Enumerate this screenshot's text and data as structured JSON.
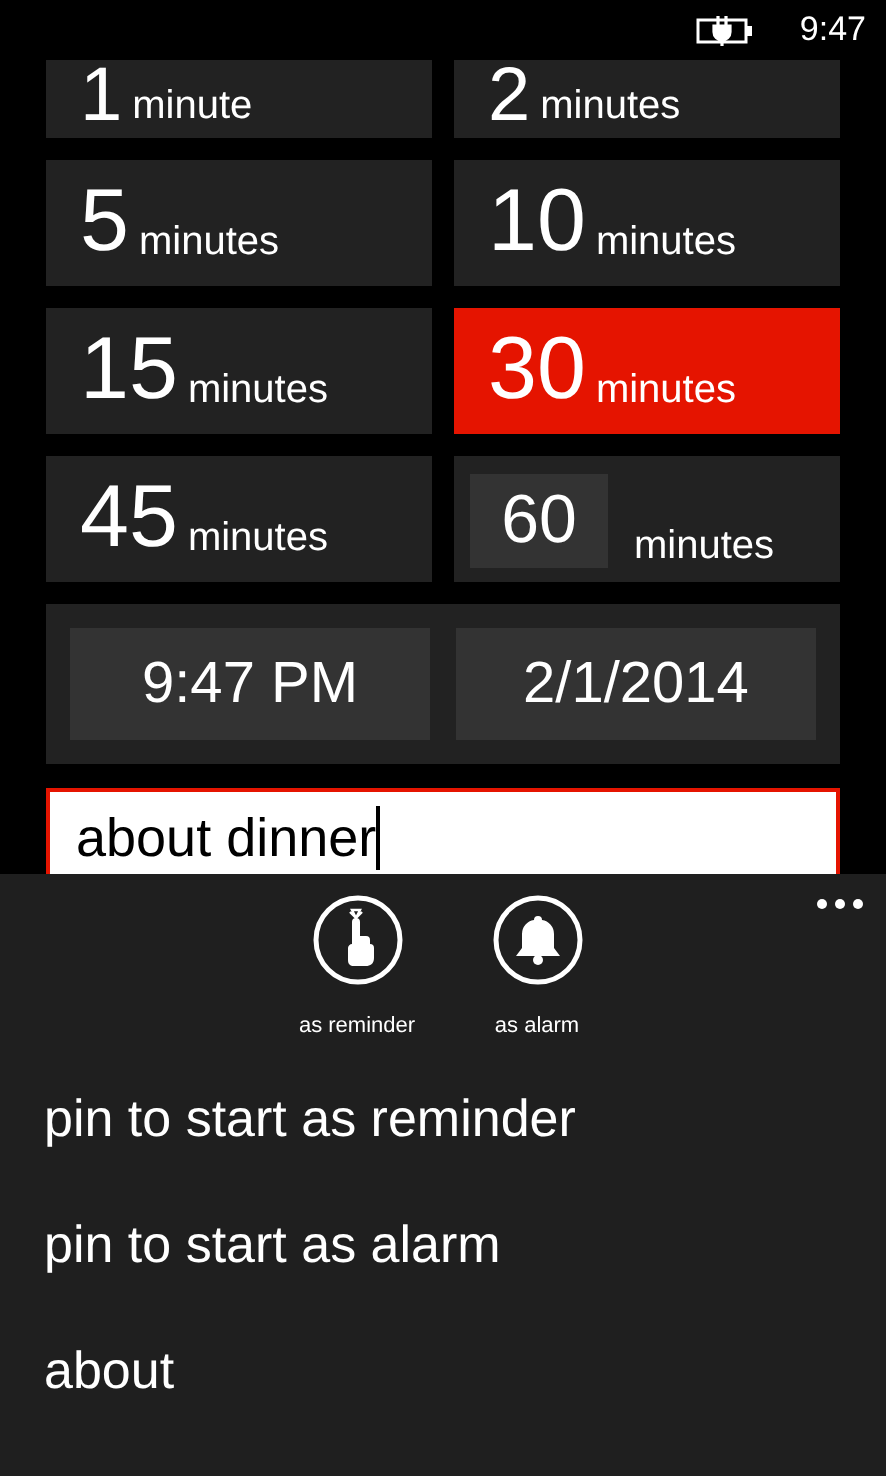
{
  "status_bar": {
    "time": "9:47"
  },
  "durations": [
    {
      "kind": "preset",
      "number": "1",
      "unit": "minute",
      "selected": false
    },
    {
      "kind": "preset",
      "number": "2",
      "unit": "minutes",
      "selected": false
    },
    {
      "kind": "preset",
      "number": "5",
      "unit": "minutes",
      "selected": false
    },
    {
      "kind": "preset",
      "number": "10",
      "unit": "minutes",
      "selected": false
    },
    {
      "kind": "preset",
      "number": "15",
      "unit": "minutes",
      "selected": false
    },
    {
      "kind": "preset",
      "number": "30",
      "unit": "minutes",
      "selected": true
    },
    {
      "kind": "preset",
      "number": "45",
      "unit": "minutes",
      "selected": false
    },
    {
      "kind": "custom",
      "number": "60",
      "unit": "minutes",
      "selected": false
    }
  ],
  "time_picker": {
    "value": "9:47 PM"
  },
  "date_picker": {
    "value": "2/1/2014"
  },
  "message_field": {
    "value": "about dinner"
  },
  "app_bar": {
    "buttons": [
      {
        "kind": "reminder",
        "label": "as reminder"
      },
      {
        "kind": "alarm",
        "label": "as alarm"
      }
    ],
    "menu_items": [
      "pin to start as reminder",
      "pin to start as alarm",
      "about"
    ]
  }
}
